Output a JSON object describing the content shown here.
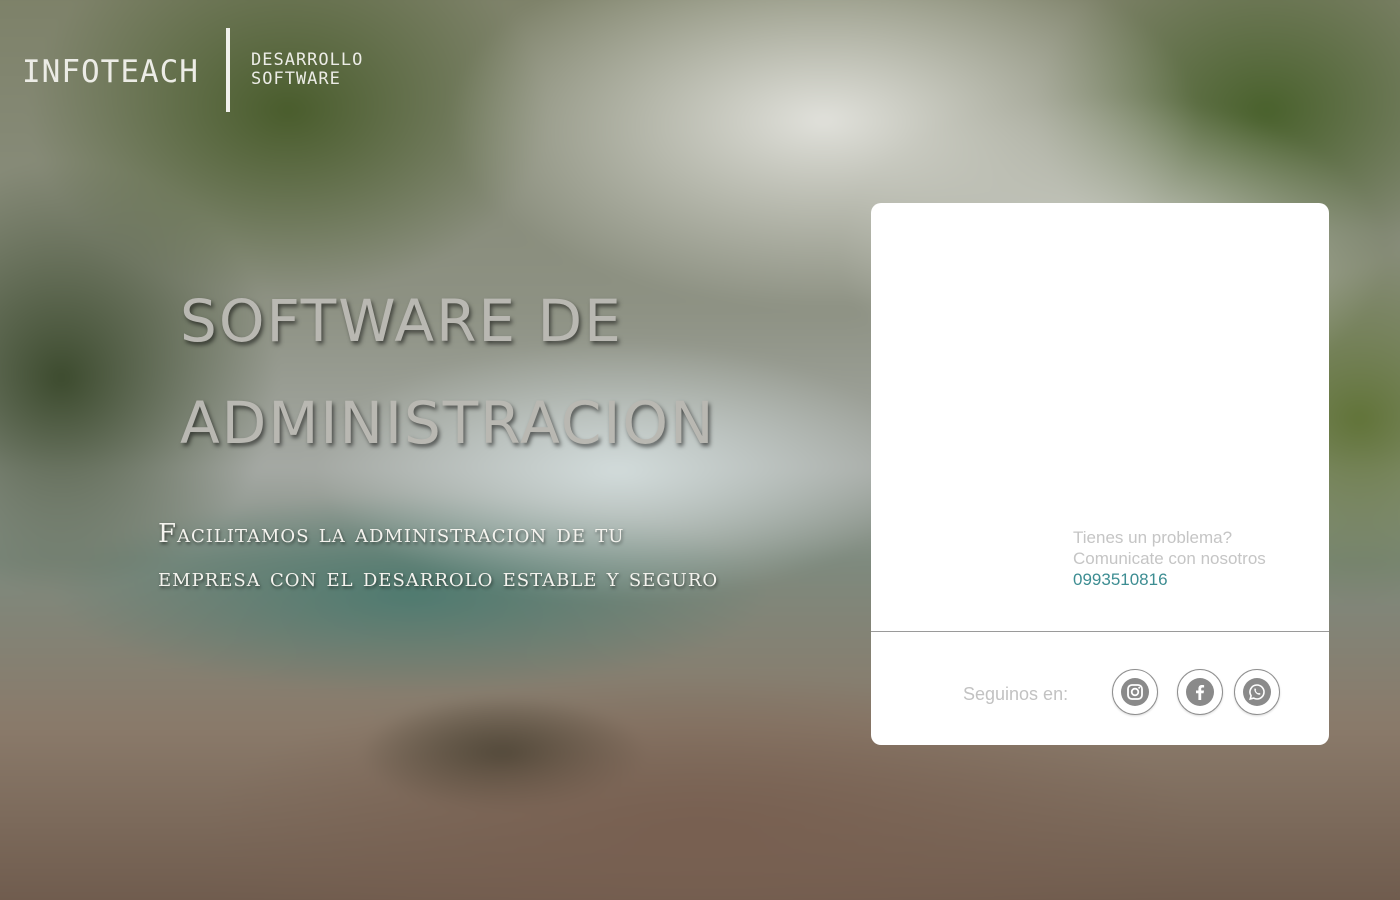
{
  "header": {
    "logo_text": "INFOTEACH",
    "tagline_line1": "DESARROLLO",
    "tagline_line2": "SOFTWARE"
  },
  "hero": {
    "title_line1": "SOFTWARE DE",
    "title_line2": "ADMINISTRACION",
    "subtitle_line1": "Facilitamos la administracion de tu",
    "subtitle_line2": "empresa con el desarrolo estable y seguro"
  },
  "panel": {
    "contact": {
      "question": "Tienes un problema?",
      "cta": "Comunicate con nosotros",
      "phone": "0993510816"
    },
    "social": {
      "label": "Seguinos en:",
      "networks": [
        {
          "icon": "instagram-icon"
        },
        {
          "icon": "facebook-icon"
        },
        {
          "icon": "whatsapp-icon"
        }
      ]
    }
  },
  "colors": {
    "accent_phone": "#3d8d92",
    "panel_bg": "#ffffff",
    "muted_text": "#c5c5c5"
  }
}
